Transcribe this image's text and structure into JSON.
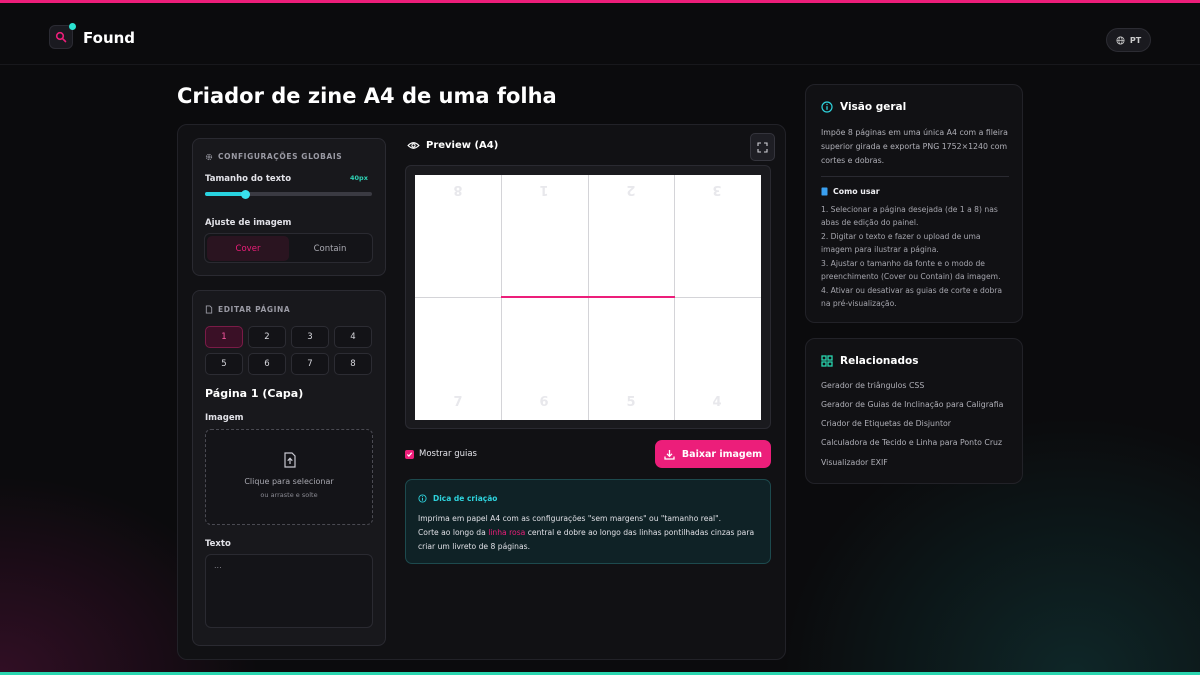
{
  "app": {
    "name": "Found",
    "language": "PT"
  },
  "page": {
    "title": "Criador de zine A4 de uma folha"
  },
  "global_settings": {
    "header": "CONFIGURAÇÕES GLOBAIS",
    "text_size_label": "Tamanho do texto",
    "text_size_value": "40px",
    "text_size_fraction": 0.24,
    "image_fit_label": "Ajuste de imagem",
    "fit_options": [
      "Cover",
      "Contain"
    ],
    "fit_selected": "Cover"
  },
  "edit_page": {
    "header": "EDITAR PÁGINA",
    "pages": [
      "1",
      "2",
      "3",
      "4",
      "5",
      "6",
      "7",
      "8"
    ],
    "selected_page": "1",
    "page_heading": "Página 1 (Capa)",
    "image_label": "Imagem",
    "upload_text": "Clique para selecionar",
    "upload_subtext": "ou arraste e solte",
    "text_label": "Texto",
    "text_placeholder": "..."
  },
  "preview": {
    "title": "Preview (A4)",
    "top_row": [
      "8",
      "1",
      "2",
      "3"
    ],
    "bottom_row": [
      "7",
      "6",
      "5",
      "4"
    ],
    "show_guides_label": "Mostrar guias",
    "show_guides_checked": true,
    "download_label": "Baixar imagem"
  },
  "tip": {
    "title": "Dica de criação",
    "line1": "Imprima em papel A4 com as configurações \"sem margens\" ou \"tamanho real\".",
    "line2_before": "Corte ao longo da ",
    "line2_highlight": "linha rosa",
    "line2_after": " central e dobre ao longo das linhas pontilhadas cinzas para criar um livreto de 8 páginas."
  },
  "overview": {
    "title": "Visão geral",
    "description": "Impõe 8 páginas em uma única A4 com a fileira superior girada e exporta PNG 1752×1240 com cortes e dobras.",
    "howto_title": "Como usar",
    "steps": [
      "1. Selecionar a página desejada (de 1 a 8) nas abas de edição do painel.",
      "2. Digitar o texto e fazer o upload de uma imagem para ilustrar a página.",
      "3. Ajustar o tamanho da fonte e o modo de preenchimento (Cover ou Contain) da imagem.",
      "4. Ativar ou desativar as guias de corte e dobra na pré-visualização."
    ]
  },
  "related": {
    "title": "Relacionados",
    "items": [
      "Gerador de triângulos CSS",
      "Gerador de Guias de Inclinação para Caligrafia",
      "Criador de Etiquetas de Disjuntor",
      "Calculadora de Tecido e Linha para Ponto Cruz",
      "Visualizador EXIF"
    ]
  },
  "colors": {
    "accent": "#ec1e7a",
    "teal": "#2ed3dd",
    "green": "#2ad6b0"
  }
}
